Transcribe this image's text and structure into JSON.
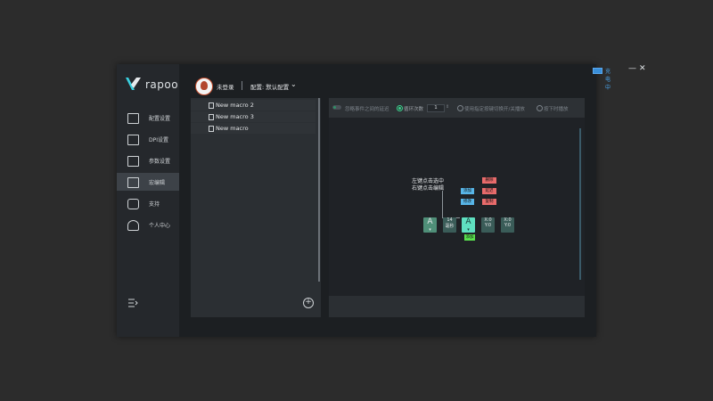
{
  "sidebar": {
    "brand": "rapoo",
    "items": [
      {
        "label": "配置设置",
        "icon": "config-icon"
      },
      {
        "label": "DPI设置",
        "icon": "dpi-icon"
      },
      {
        "label": "参数设置",
        "icon": "params-icon"
      },
      {
        "label": "宏编辑",
        "icon": "macro-icon",
        "active": true
      },
      {
        "label": "支持",
        "icon": "thumbs-up-icon"
      },
      {
        "label": "个人中心",
        "icon": "user-icon"
      }
    ],
    "collapse_icon": "menu-collapse-icon"
  },
  "header": {
    "user": "未登录",
    "config": "配置: 默认配置",
    "battery_label": "充电中",
    "colors": {
      "accent": "#3ad28c",
      "battery": "#4aa3ea"
    }
  },
  "macros": {
    "items": [
      "New macro 2",
      "New macro 3",
      "New macro"
    ]
  },
  "editor": {
    "toolbar": {
      "ignore_delay": "忽略事件之间的延迟",
      "loop_count_label": "循环次数",
      "loop_count_value": "1",
      "toggle_mode": "使用指定按键切换开/关播放",
      "hold_mode": "按下时播放"
    },
    "hint_line1": "左键点击选中",
    "hint_line2": "右键点击编辑",
    "context_menu": {
      "add": "添加",
      "modify": "修改",
      "delete": "删除",
      "delay": "延迟",
      "copy": "复制"
    },
    "nodes": [
      {
        "big": "A",
        "small": "▾"
      },
      {
        "top": "14",
        "bottom": "毫秒"
      },
      {
        "big": "A",
        "small": "▾"
      },
      {
        "top": "X:0",
        "bottom": "Y:0"
      },
      {
        "top": "X:0",
        "bottom": "Y:0"
      }
    ],
    "node_tag": "添加"
  }
}
